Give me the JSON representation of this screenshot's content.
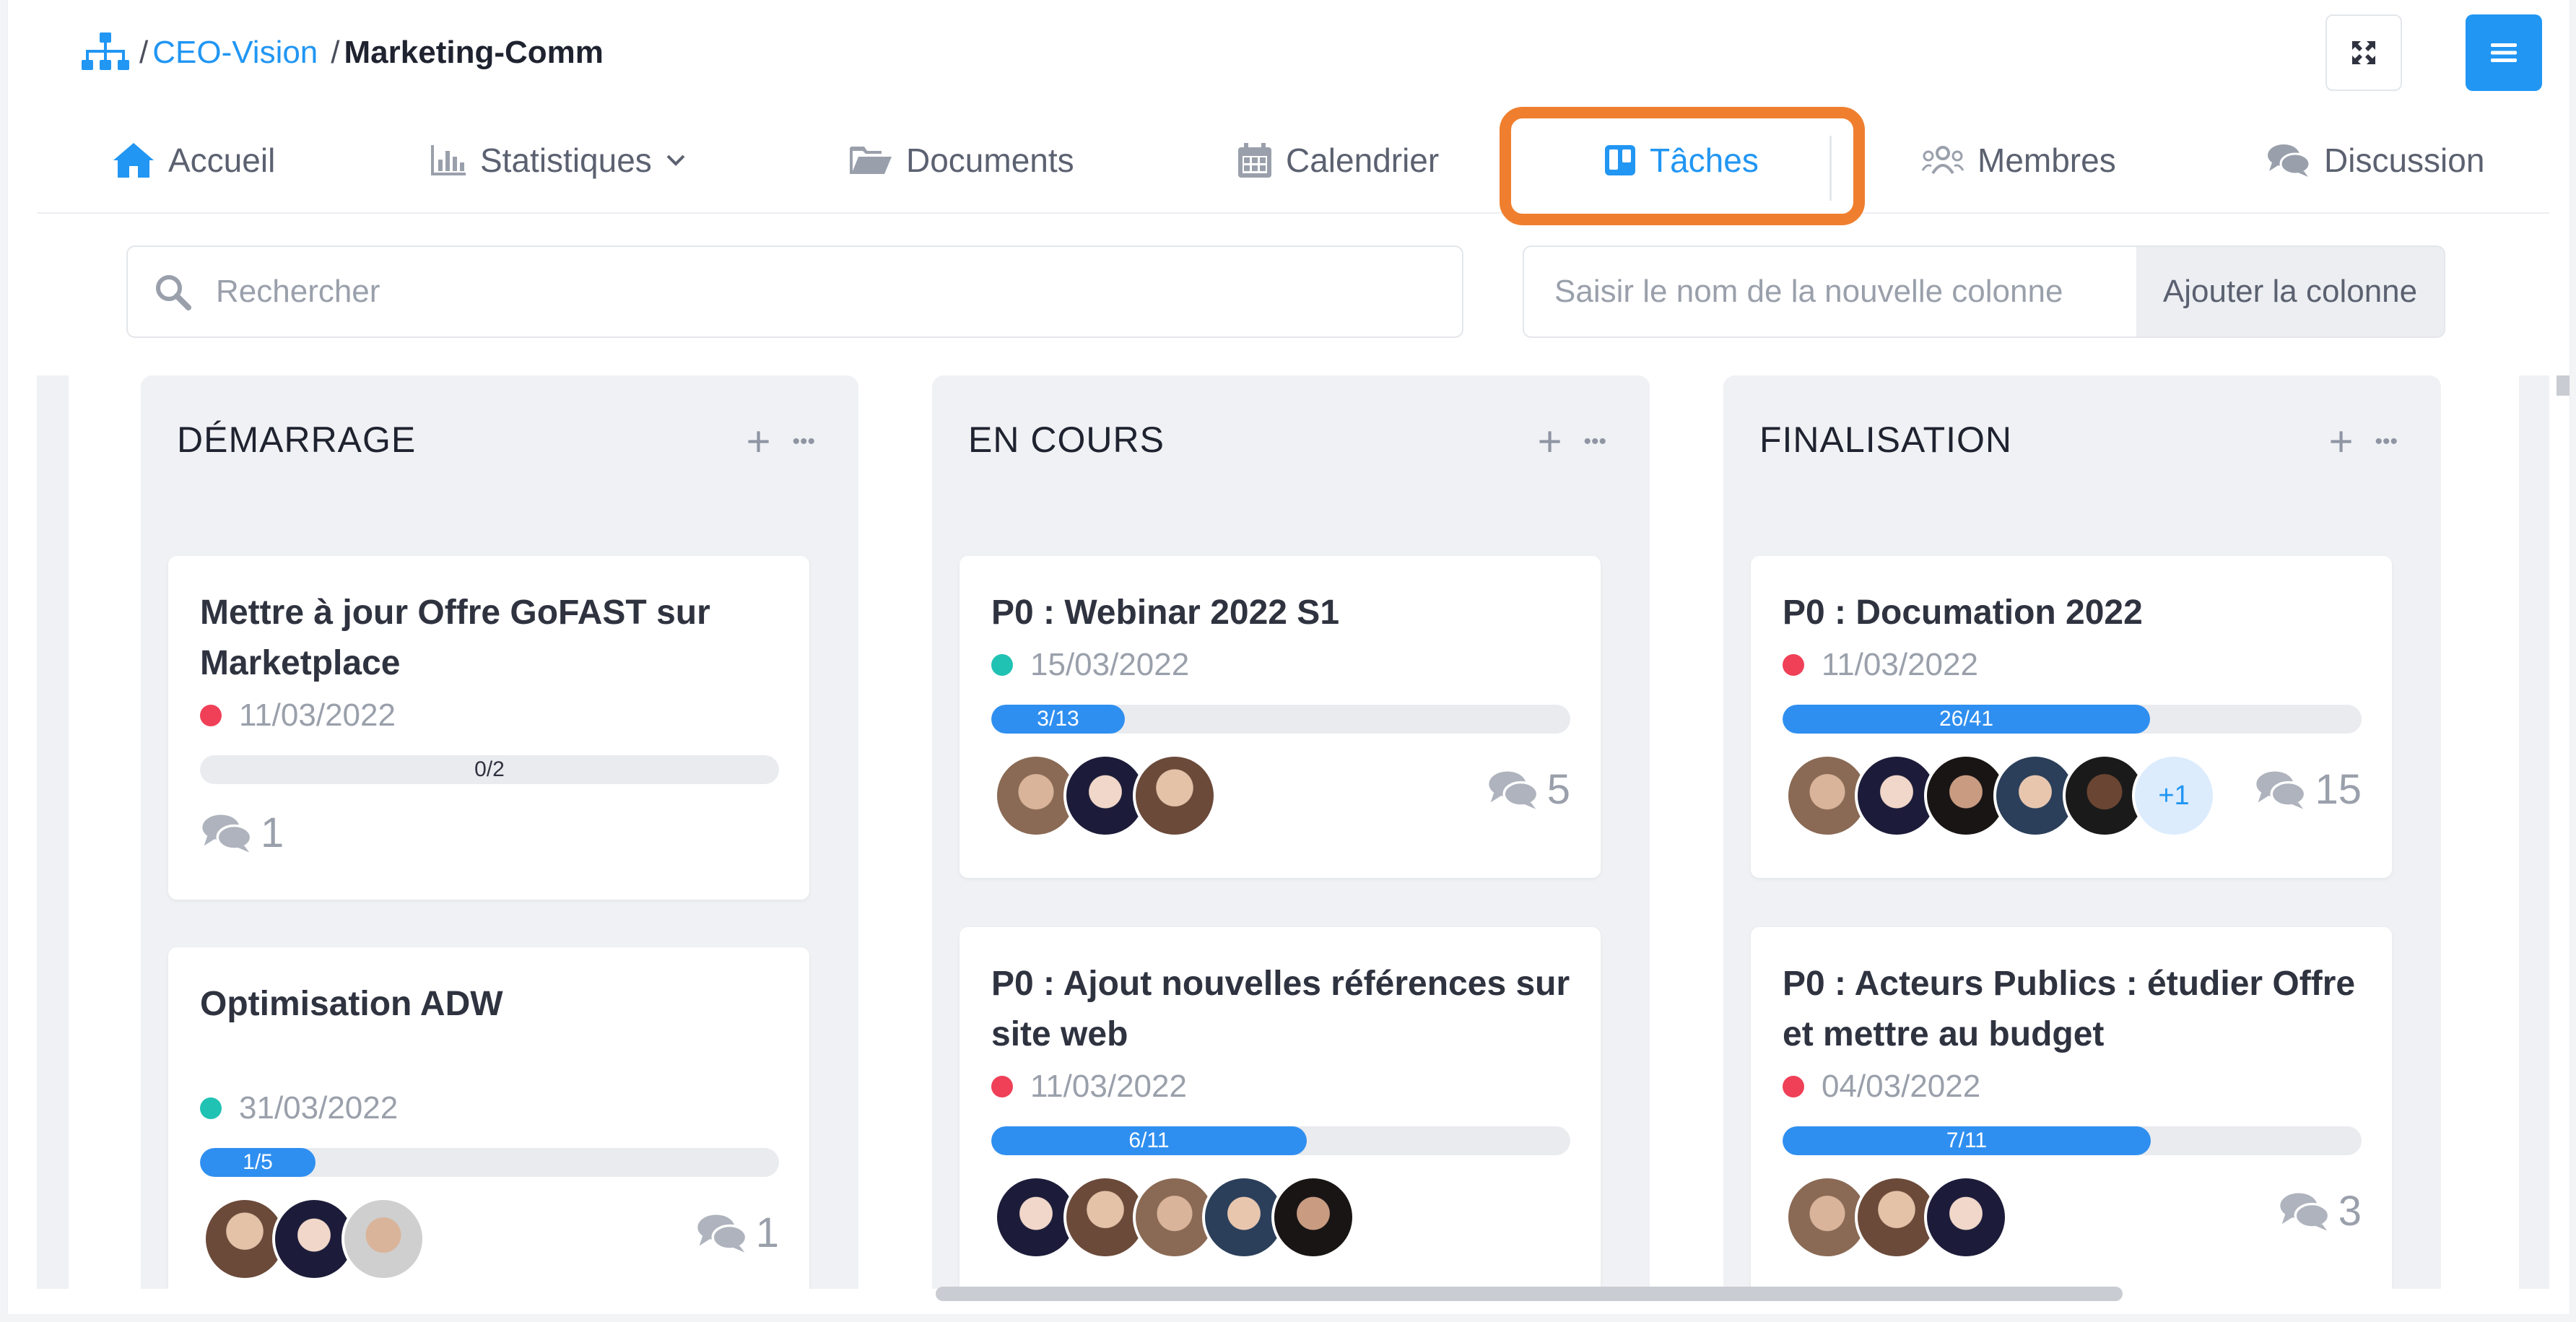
{
  "breadcrumb": {
    "sep": "/",
    "group": "CEO-Vision",
    "current": "Marketing-Comm"
  },
  "tabs": [
    {
      "label": "Accueil",
      "icon": "home-icon"
    },
    {
      "label": "Statistiques",
      "icon": "bar-chart-icon"
    },
    {
      "label": "Documents",
      "icon": "folder-open-icon"
    },
    {
      "label": "Calendrier",
      "icon": "calendar-icon"
    },
    {
      "label": "Tâches",
      "icon": "trello-board-icon",
      "active": true
    },
    {
      "label": "Membres",
      "icon": "users-icon"
    },
    {
      "label": "Discussion",
      "icon": "comments-icon"
    }
  ],
  "search": {
    "placeholder": "Rechercher"
  },
  "new_column": {
    "placeholder": "Saisir le nom de la nouvelle colonne",
    "button": "Ajouter la colonne"
  },
  "colors": {
    "accent": "#2196f3",
    "highlight": "#ef7f2e",
    "red_dot": "#ef4058",
    "teal_dot": "#20c2b4"
  },
  "columns": [
    {
      "title": "DÉMARRAGE",
      "actions": {
        "add": "+",
        "more": "•••"
      },
      "cards": [
        {
          "title": "Mettre à jour Offre GoFAST sur Marketplace",
          "date": "11/03/2022",
          "status": "red",
          "progress": {
            "label": "0/2",
            "done": 0,
            "total": 2
          },
          "comments": "1",
          "avatars": []
        },
        {
          "title": "Optimisation ADW",
          "date": "31/03/2022",
          "status": "teal",
          "progress": {
            "label": "1/5",
            "done": 1,
            "total": 5
          },
          "comments": "1",
          "avatars": [
            "a2",
            "a3",
            "a1"
          ]
        }
      ]
    },
    {
      "title": "EN COURS",
      "actions": {
        "add": "+",
        "more": "•••"
      },
      "cards": [
        {
          "title": "P0 : Webinar 2022 S1",
          "date": "15/03/2022",
          "status": "teal",
          "progress": {
            "label": "3/13",
            "done": 3,
            "total": 13
          },
          "comments": "5",
          "avatars": [
            "a1",
            "a3",
            "a2"
          ]
        },
        {
          "title": "P0 : Ajout nouvelles références sur site web",
          "date": "11/03/2022",
          "status": "red",
          "progress": {
            "label": "6/11",
            "done": 6,
            "total": 11
          },
          "comments": "",
          "avatars": [
            "a3",
            "a2",
            "a1",
            "a4",
            "a5"
          ]
        }
      ]
    },
    {
      "title": "FINALISATION",
      "actions": {
        "add": "+",
        "more": "•••"
      },
      "cards": [
        {
          "title": "P0 : Documation 2022",
          "date": "11/03/2022",
          "status": "red",
          "progress": {
            "label": "26/41",
            "done": 26,
            "total": 41
          },
          "comments": "15",
          "avatars": [
            "a1",
            "a3",
            "a5",
            "a4",
            "a6"
          ],
          "more_avatars": "+1"
        },
        {
          "title": "P0 : Acteurs Publics : étudier Offre et mettre au budget",
          "date": "04/03/2022",
          "status": "red",
          "progress": {
            "label": "7/11",
            "done": 7,
            "total": 11
          },
          "comments": "3",
          "avatars": [
            "a1",
            "a2",
            "a3"
          ]
        }
      ]
    }
  ]
}
